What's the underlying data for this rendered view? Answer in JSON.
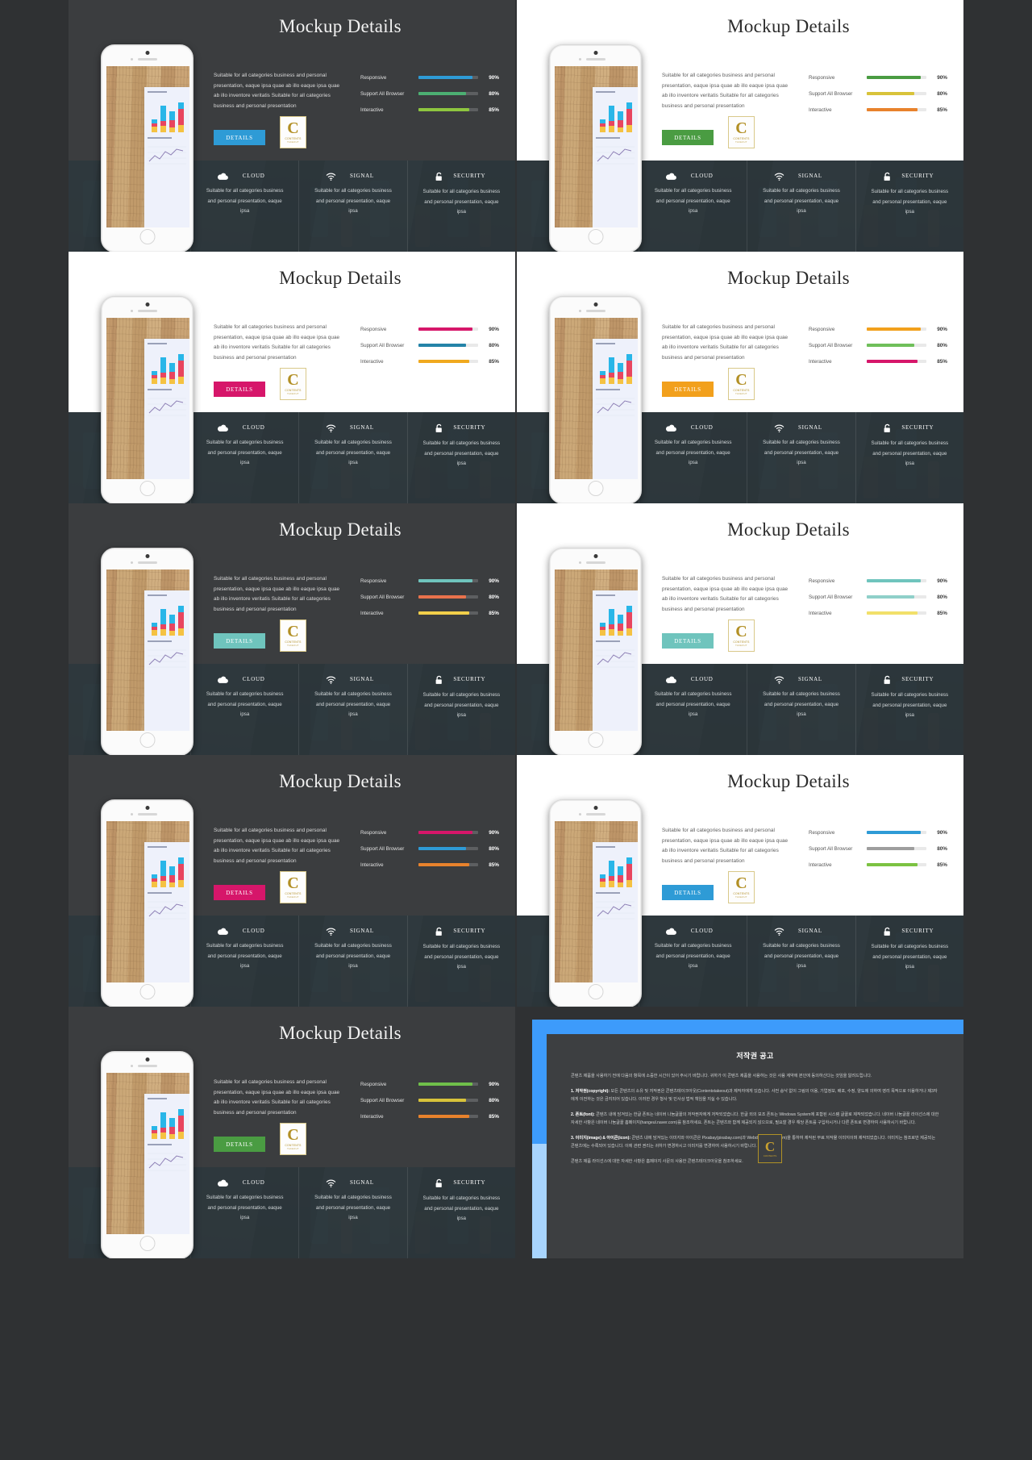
{
  "slide_title": "Mockup Details",
  "body_copy": "Suitable for all categories business and personal presentation, eaque ipsa quae ab illo eaque ipsa quae ab illo inventore veritatis Suitable for all categories business and personal presentation",
  "details_button": "DETAILS",
  "badge": {
    "letter": "C",
    "label": "CONTENTS",
    "sub": "TAKEOUT"
  },
  "stats": {
    "labels": [
      "Responsive",
      "Support All Browser",
      "Interactive"
    ],
    "values": [
      90,
      80,
      85
    ],
    "display": [
      "90%",
      "80%",
      "85%"
    ]
  },
  "features": [
    {
      "icon": "cloud-icon",
      "name": "CLOUD",
      "desc": "Suitable for all categories business and personal presentation, eaque ipsa"
    },
    {
      "icon": "wifi-icon",
      "name": "SIGNAL",
      "desc": "Suitable for all categories business and personal presentation, eaque ipsa"
    },
    {
      "icon": "lock-icon",
      "name": "SECURITY",
      "desc": "Suitable for all categories business and personal presentation, eaque ipsa"
    }
  ],
  "slides": [
    {
      "id": "slide-1",
      "theme": "dark",
      "button_color": "#2e9bd6",
      "bar_colors": [
        "#2e9bd6",
        "#4caf72",
        "#8ec63f"
      ]
    },
    {
      "id": "slide-2",
      "theme": "light",
      "button_color": "#4a9c42",
      "bar_colors": [
        "#4a9c42",
        "#d8c33a",
        "#e8822c"
      ]
    },
    {
      "id": "slide-3",
      "theme": "light",
      "button_color": "#d6166a",
      "bar_colors": [
        "#d6166a",
        "#2483a8",
        "#f0a91e"
      ]
    },
    {
      "id": "slide-4",
      "theme": "light",
      "button_color": "#f2a01c",
      "bar_colors": [
        "#f2a01c",
        "#6fbf5a",
        "#d6166a"
      ]
    },
    {
      "id": "slide-5",
      "theme": "dark",
      "button_color": "#6fc4bd",
      "bar_colors": [
        "#6fc4bd",
        "#e8724c",
        "#f2cf4a"
      ]
    },
    {
      "id": "slide-6",
      "theme": "light",
      "button_color": "#6fc4bd",
      "bar_colors": [
        "#6fc4bd",
        "#8fd0c9",
        "#f2e06a"
      ]
    },
    {
      "id": "slide-7",
      "theme": "dark",
      "button_color": "#d6166a",
      "bar_colors": [
        "#d6166a",
        "#2e9bd6",
        "#e8822c"
      ]
    },
    {
      "id": "slide-8",
      "theme": "light",
      "button_color": "#2e9bd6",
      "bar_colors": [
        "#2e9bd6",
        "#9e9e9e",
        "#7cc242"
      ]
    },
    {
      "id": "slide-9",
      "theme": "dark",
      "button_color": "#4a9c42",
      "bar_colors": [
        "#6fbf4a",
        "#d8c33a",
        "#e8822c"
      ]
    }
  ],
  "copyright": {
    "heading": "저작권 공고",
    "intro": "콘텐츠 제품을 사용하기 전에 다음의 항목에 소중한 시간이 있어 주시기 바랍니다. 귀하가 이 콘텐츠 제품을 사용하는 것은 사용 계약에 본인에 동의하신다는 것임을 알려드립니다.",
    "items": [
      {
        "title": "1. 저작권(copyright):",
        "text": "모든 콘텐츠의 소유 및 저작권은 콘텐츠테이크아웃(Contentstakeout)과 제작자에게 있습니다. 사전 승낙 없이 그림의 이용, 기업정보, 배포, 수정, 양도에 의하여 영리 목적으로 이용하거나 제3자에게 이전하는 것은 금지되어 있습니다. 이러한 경우 형사 및 민사상 법적 책임을 지실 수 있습니다."
      },
      {
        "title": "2. 폰트(font):",
        "text": "콘텐츠 내에 담겨있는 한글 폰트는 네이버 나눔글꼴의 저작권자에게 저작되었습니다. 한글 외의 보조 폰트는 Windows System에 포함된 시스템 글꼴로 제작되었습니다. 네이버 나눔글꼴 라이선스에 대한 자세한 사항은 네이버 나눔글꼴 홈페이지(hangeul.naver.com)를 참조하세요. 폰트는 콘텐츠와 함께 제공되지 않으므로, 필요할 경우 해당 폰트를 구입하시거나 다른 폰트로 변경하여 사용하시기 바랍니다."
      },
      {
        "title": "3. 이미지(image) & 아이콘(icon):",
        "text": "콘텐츠 내에 담겨있는 이미지와 아이콘은 Pixabay(pixabay.com)과 Webdly(webdlys.com)을 통하여 제작된 무료 저작물 이미지이며 제작되었습니다. 이미지는 참조로만 제공되는 콘텐츠에는 수록되어 있습니다. 이에 관련 권리는 귀하가 변경하시고 이미지를 변경하여 사용하시기 바랍니다."
      }
    ],
    "footer": "콘텐츠 제품 라이선스에 대한 자세한 사항은 홈페이지 사문의 사용한 콘텐츠테이크아웃을 참조하세요."
  }
}
